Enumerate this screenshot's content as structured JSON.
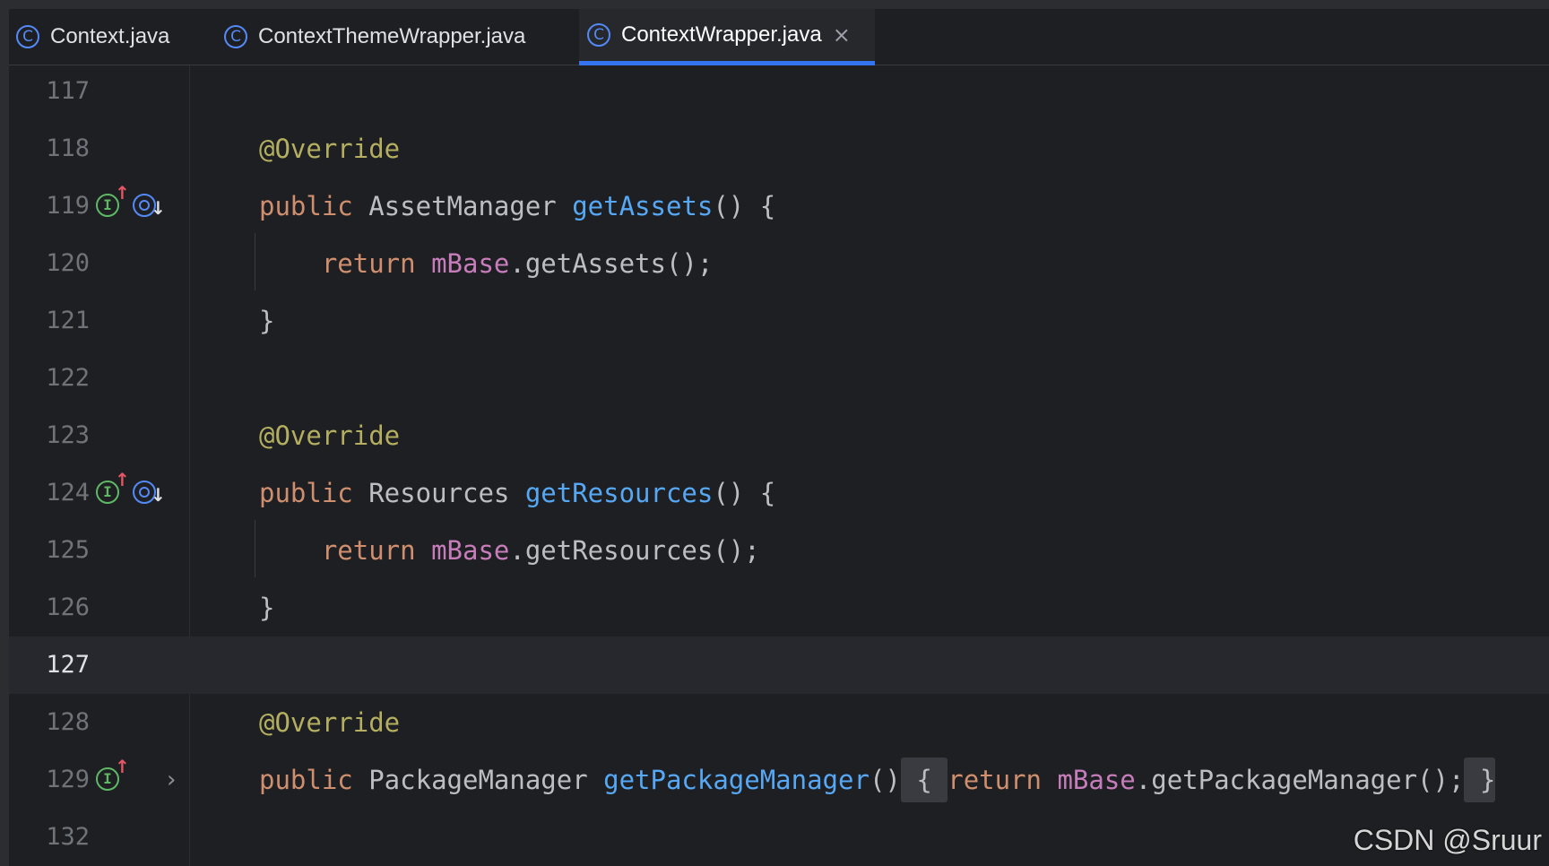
{
  "tabs": [
    {
      "label": "Context.java",
      "icon": "class-icon",
      "active": false
    },
    {
      "label": "ContextThemeWrapper.java",
      "icon": "class-icon",
      "active": false
    },
    {
      "label": "ContextWrapper.java",
      "icon": "class-icon",
      "active": true,
      "close_glyph": "×"
    }
  ],
  "tab_icon_glyph": "C",
  "gutter": {
    "implements_glyph": "I",
    "up_arrow": "↑",
    "down_arrow": "↓",
    "fold_glyph": "›"
  },
  "lines": [
    {
      "num": "117"
    },
    {
      "num": "118",
      "tokens": [
        {
          "t": "ann",
          "v": "@Override"
        }
      ]
    },
    {
      "num": "119",
      "tokens": [
        {
          "t": "kw",
          "v": "public"
        },
        {
          "t": "typ",
          "v": " AssetManager "
        },
        {
          "t": "fn",
          "v": "getAssets"
        },
        {
          "t": "typ",
          "v": "() {"
        }
      ]
    },
    {
      "num": "120",
      "tokens": [
        {
          "t": "kw",
          "v": "    return "
        },
        {
          "t": "fld",
          "v": "mBase"
        },
        {
          "t": "typ",
          "v": ".getAssets();"
        }
      ]
    },
    {
      "num": "121",
      "tokens": [
        {
          "t": "typ",
          "v": "}"
        }
      ]
    },
    {
      "num": "122"
    },
    {
      "num": "123",
      "tokens": [
        {
          "t": "ann",
          "v": "@Override"
        }
      ]
    },
    {
      "num": "124",
      "tokens": [
        {
          "t": "kw",
          "v": "public"
        },
        {
          "t": "typ",
          "v": " Resources "
        },
        {
          "t": "fn",
          "v": "getResources"
        },
        {
          "t": "typ",
          "v": "() {"
        }
      ]
    },
    {
      "num": "125",
      "tokens": [
        {
          "t": "kw",
          "v": "    return "
        },
        {
          "t": "fld",
          "v": "mBase"
        },
        {
          "t": "typ",
          "v": ".getResources();"
        }
      ]
    },
    {
      "num": "126",
      "tokens": [
        {
          "t": "typ",
          "v": "}"
        }
      ]
    },
    {
      "num": "127",
      "current": true
    },
    {
      "num": "128",
      "tokens": [
        {
          "t": "ann",
          "v": "@Override"
        }
      ]
    },
    {
      "num": "129",
      "tokens": [
        {
          "t": "kw",
          "v": "public"
        },
        {
          "t": "typ",
          "v": " PackageManager "
        },
        {
          "t": "fn",
          "v": "getPackageManager"
        },
        {
          "t": "typ",
          "v": "()"
        },
        {
          "t": "fold",
          "v": " { "
        },
        {
          "t": "kw",
          "v": "return "
        },
        {
          "t": "fld",
          "v": "mBase"
        },
        {
          "t": "typ",
          "v": ".getPackageManager();"
        },
        {
          "t": "fold",
          "v": " }"
        }
      ]
    },
    {
      "num": "132"
    }
  ],
  "watermark": "CSDN @Sruur",
  "colors": {
    "background": "#1e1f22",
    "keyword": "#cf8e6d",
    "annotation": "#b3ae60",
    "method": "#56a8f5",
    "field": "#c77dbb",
    "text": "#bcbec4",
    "tab_underline": "#3574f0"
  }
}
